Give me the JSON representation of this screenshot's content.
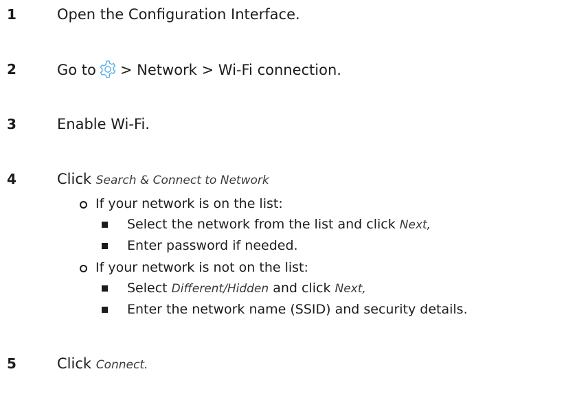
{
  "steps": [
    {
      "number": "1",
      "text": "Open the Configuration Interface."
    },
    {
      "number": "2",
      "text_before": "Go to",
      "icon": "gear-icon",
      "text_after": "> Network > Wi-Fi connection."
    },
    {
      "number": "3",
      "text": "Enable Wi-Fi."
    },
    {
      "number": "4",
      "text_before": "Click",
      "italic": "Search & Connect to Network",
      "options": [
        {
          "text": "If your network is on the list:",
          "items": [
            {
              "text_before": "Select the network from the list and click",
              "italic": "Next,"
            },
            {
              "text": "Enter password if needed."
            }
          ]
        },
        {
          "text": "If your network is not on the list:",
          "items": [
            {
              "text_before": "Select",
              "italic": "Different/Hidden",
              "text_mid": "and click",
              "italic2": "Next,"
            },
            {
              "text": "Enter the network name (SSID) and security details."
            }
          ]
        }
      ]
    },
    {
      "number": "5",
      "text_before": "Click",
      "italic": "Connect."
    }
  ],
  "colors": {
    "text": "#1c1c1c",
    "icon": "#4aa8e8"
  }
}
